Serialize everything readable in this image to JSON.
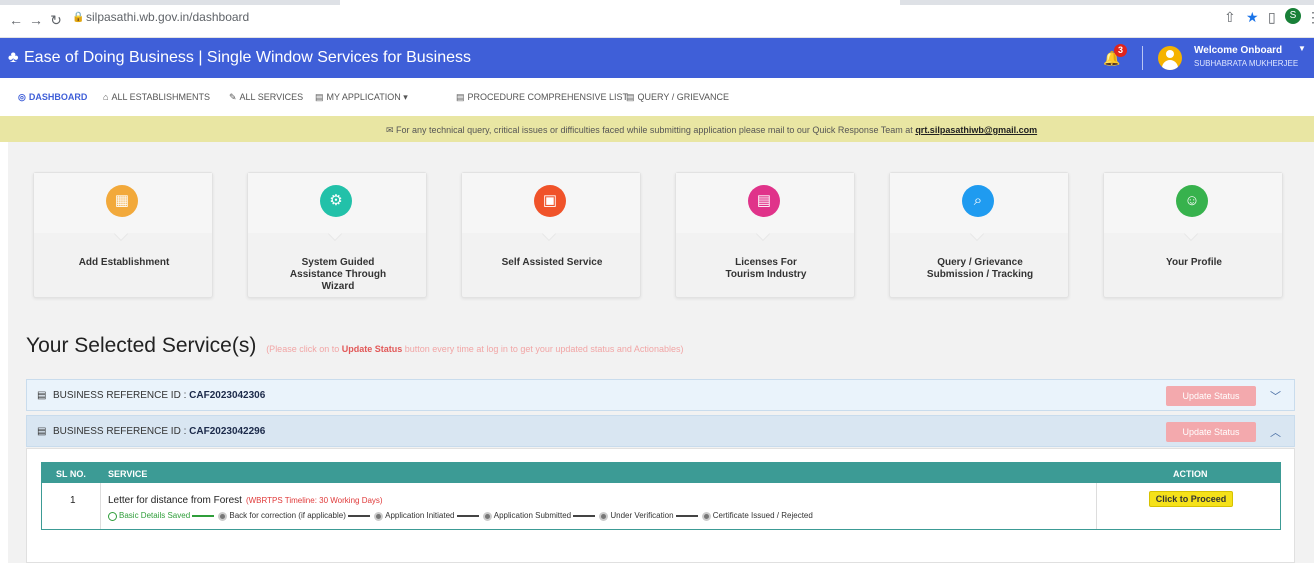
{
  "browser": {
    "url": "silpasathi.wb.gov.in/dashboard"
  },
  "header": {
    "title": "Ease of Doing Business | Single Window Services for Business",
    "notification_count": "3",
    "welcome": "Welcome Onboard",
    "username": "SUBHABRATA MUKHERJEE",
    "brand_color": "#3f5fd8"
  },
  "menu": {
    "items": [
      {
        "label": "DASHBOARD",
        "icon": "dashboard-icon"
      },
      {
        "label": "ALL ESTABLISHMENTS",
        "icon": "building-icon"
      },
      {
        "label": "ALL SERVICES",
        "icon": "wrench-icon"
      },
      {
        "label": "MY APPLICATION",
        "icon": "document-icon"
      },
      {
        "label": "PROCEDURE COMPREHENSIVE LIST",
        "icon": "list-icon"
      },
      {
        "label": "QUERY / GRIEVANCE",
        "icon": "list-icon"
      }
    ]
  },
  "notice": {
    "text": "For any technical query, critical issues or difficulties faced while submitting application please mail to our Quick Response Team at",
    "email": "qrt.silpasathiwb@gmail.com"
  },
  "cards": [
    {
      "label": "Add Establishment",
      "icon": "building-icon",
      "color": "#f2a93b"
    },
    {
      "label": "System Guided Assistance Through Wizard",
      "icon": "gear-icon",
      "color": "#22c1a9"
    },
    {
      "label": "Self Assisted Service",
      "icon": "grid-icon",
      "color": "#f0532a"
    },
    {
      "label": "Licenses For Tourism Industry",
      "icon": "license-icon",
      "color": "#e0338a"
    },
    {
      "label": "Query / Grievance Submission / Tracking",
      "icon": "search-icon",
      "color": "#1f9bf0"
    },
    {
      "label": "Your Profile",
      "icon": "profile-icon",
      "color": "#37b24d"
    }
  ],
  "section": {
    "title": "Your Selected Service(s)",
    "note_prefix": "(Please click on to",
    "note_bold": "Update Status",
    "note_suffix": "button every time at log in to get your updated status and Actionables)"
  },
  "references": [
    {
      "label": "BUSINESS REFERENCE ID :",
      "id": "CAF2023042306",
      "button": "Update Status"
    },
    {
      "label": "BUSINESS REFERENCE ID :",
      "id": "CAF2023042296",
      "button": "Update Status"
    }
  ],
  "table": {
    "headers": {
      "sl": "SL NO.",
      "service": "SERVICE",
      "action": "ACTION"
    },
    "rows": [
      {
        "sl": "1",
        "service": "Letter for distance from Forest",
        "timeline": "(WBRTPS Timeline: 30 Working Days)",
        "action": "Click to Proceed",
        "steps": [
          "Basic Details Saved",
          "Back for correction (if applicable)",
          "Application Initiated",
          "Application Submitted",
          "Under Verification",
          "Certificate Issued / Rejected"
        ]
      }
    ]
  }
}
